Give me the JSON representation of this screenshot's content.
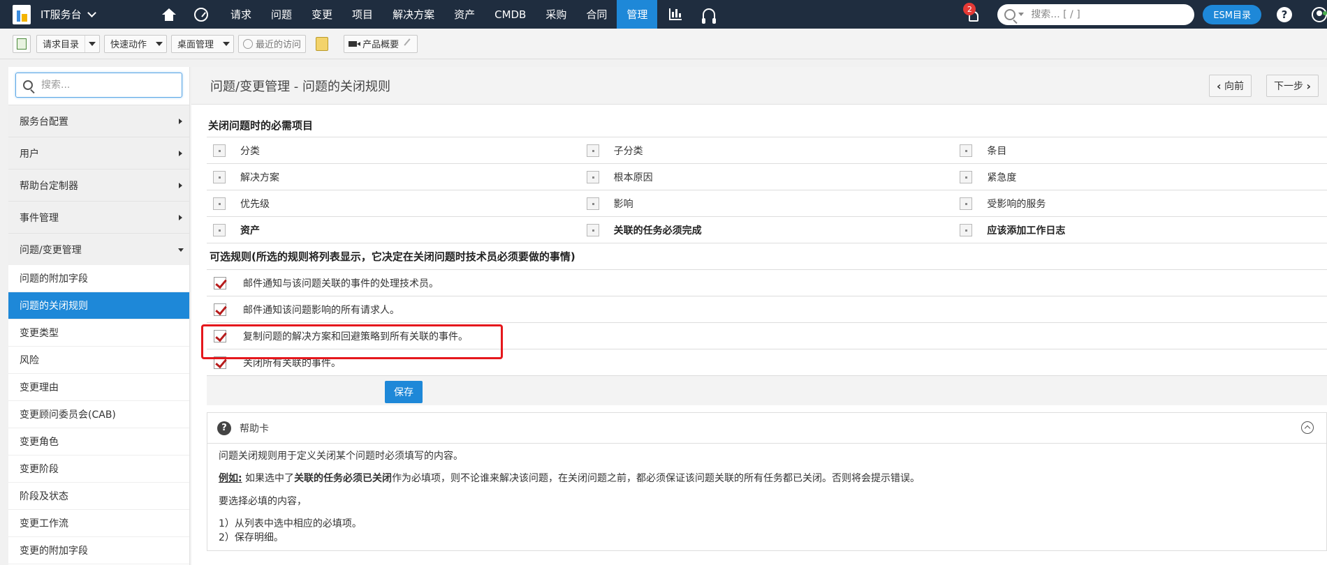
{
  "app": {
    "brand": "IT服务台",
    "nav": [
      "请求",
      "问题",
      "变更",
      "项目",
      "解决方案",
      "资产",
      "CMDB",
      "采购",
      "合同",
      "管理"
    ],
    "active_nav": "管理",
    "notification_count": "2",
    "search_placeholder": "搜索... [ / ]",
    "esm_label": "ESM目录",
    "help_label": "?"
  },
  "toolbar": {
    "request_catalog": "请求目录",
    "quick_actions": "快速动作",
    "desktop_mgmt": "桌面管理",
    "recent": "最近的访问",
    "product_overview": "产品概要"
  },
  "sidebar": {
    "search_placeholder": "搜索...",
    "groups": [
      "服务台配置",
      "用户",
      "帮助台定制器",
      "事件管理",
      "问题/变更管理"
    ],
    "items": [
      "问题的附加字段",
      "问题的关闭规则",
      "变更类型",
      "风险",
      "变更理由",
      "变更顾问委员会(CAB)",
      "变更角色",
      "变更阶段",
      "阶段及状态",
      "变更工作流",
      "变更的附加字段"
    ],
    "active_item": "问题的关闭规则"
  },
  "page": {
    "title": "问题/变更管理 - 问题的关闭规则",
    "prev": "向前",
    "next": "下一步",
    "required_title": "关闭问题时的必需项目",
    "required": [
      [
        "分类",
        "子分类",
        "条目"
      ],
      [
        "解决方案",
        "根本原因",
        "紧急度"
      ],
      [
        "优先级",
        "影响",
        "受影响的服务"
      ],
      [
        "资产",
        "关联的任务必须完成",
        "应该添加工作日志"
      ]
    ],
    "optional_title": "可选规则(所选的规则将列表显示，它决定在关闭问题时技术员必须要做的事情)",
    "optional": [
      "邮件通知与该问题关联的事件的处理技术员。",
      "邮件通知该问题影响的所有请求人。",
      "复制问题的解决方案和回避策略到所有关联的事件。",
      "关闭所有关联的事件。"
    ],
    "save": "保存"
  },
  "help": {
    "title": "帮助卡",
    "line1": "问题关闭规则用于定义关闭某个问题时必须填写的内容。",
    "eg_label": "例如:",
    "eg_pre": " 如果选中了",
    "eg_bold": "关联的任务必须已关闭",
    "eg_post": "作为必填项，则不论谁来解决该问题，在关闭问题之前，都必须保证该问题关联的所有任务都已关闭。否则将会提示错误。",
    "line3": "要选择必填的内容，",
    "step1": "1）从列表中选中相应的必填项。",
    "step2": "2）保存明细。"
  }
}
